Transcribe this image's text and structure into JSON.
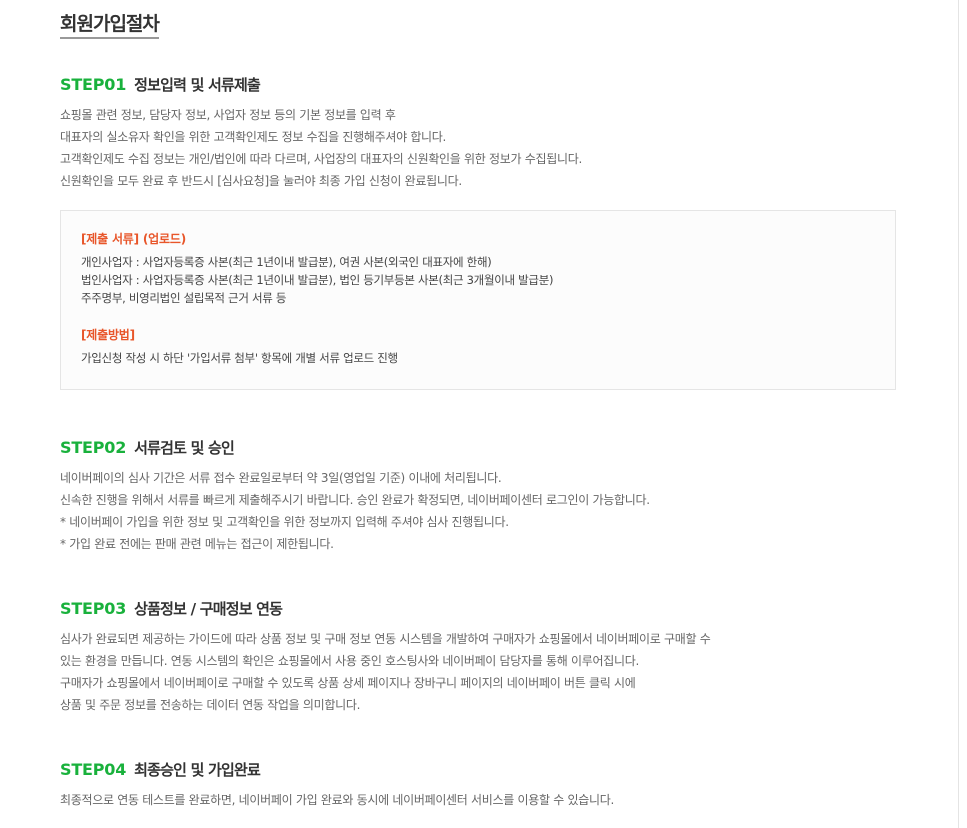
{
  "page_title": "회원가입절차",
  "steps": [
    {
      "num": "STEP01",
      "title": "정보입력 및 서류제출",
      "lines": [
        "쇼핑몰 관련 정보, 담당자 정보, 사업자 정보 등의 기본 정보를 입력 후",
        "대표자의 실소유자 확인을 위한 고객확인제도 정보 수집을 진행해주셔야 합니다.",
        "고객확인제도 수집 정보는 개인/법인에 따라 다르며, 사업장의 대표자의 신원확인을 위한 정보가 수집됩니다.",
        "신원확인을 모두 완료 후 반드시 [심사요청]을 눌러야 최종 가입 신청이 완료됩니다."
      ]
    },
    {
      "num": "STEP02",
      "title": "서류검토 및 승인",
      "lines": [
        "네이버페이의 심사 기간은 서류 접수 완료일로부터 약 3일(영업일 기준) 이내에 처리됩니다.",
        "신속한 진행을 위해서 서류를 빠르게 제출해주시기 바랍니다. 승인 완료가 확정되면, 네이버페이센터 로그인이 가능합니다.",
        "* 네이버페이 가입을 위한 정보 및 고객확인을 위한 정보까지 입력해 주셔야 심사 진행됩니다.",
        "* 가입 완료 전에는 판매 관련 메뉴는 접근이 제한됩니다."
      ]
    },
    {
      "num": "STEP03",
      "title": "상품정보 / 구매정보 연동",
      "lines": [
        "심사가 완료되면 제공하는 가이드에 따라 상품 정보 및 구매 정보 연동 시스템을 개발하여 구매자가 쇼핑몰에서 네이버페이로 구매할 수",
        "있는 환경을 만듭니다. 연동 시스템의 확인은 쇼핑몰에서 사용 중인 호스팅사와 네이버페이 담당자를 통해 이루어집니다.",
        "구매자가 쇼핑몰에서 네이버페이로 구매할 수 있도록 상품 상세 페이지나 장바구니 페이지의 네이버페이 버튼 클릭 시에",
        "상품 및 주문 정보를 전송하는 데이터 연동 작업을 의미합니다."
      ]
    },
    {
      "num": "STEP04",
      "title": "최종승인 및 가입완료",
      "lines": [
        "최종적으로 연동 테스트를 완료하면, 네이버페이 가입 완료와 동시에 네이버페이센터 서비스를 이용할 수 있습니다."
      ]
    }
  ],
  "documents_box": {
    "submit_heading": "[제출 서류] (업로드)",
    "submit_lines": [
      "개인사업자 : 사업자등록증 사본(최근 1년이내 발급분), 여권 사본(외국인 대표자에 한해)",
      "법인사업자 : 사업자등록증 사본(최근 1년이내 발급분), 법인 등기부등본 사본(최근 3개월이내 발급분)",
      "주주명부, 비영리법인 설립목적 근거 서류 등"
    ],
    "method_heading": "[제출방법]",
    "method_lines": [
      "가입신청 작성 시 하단 '가입서류 첨부' 항목에 개별 서류 업로드 진행"
    ]
  },
  "colors": {
    "step_accent": "#19b13c",
    "box_heading": "#e8562a",
    "title_text": "#333333",
    "body_text": "#666666"
  }
}
